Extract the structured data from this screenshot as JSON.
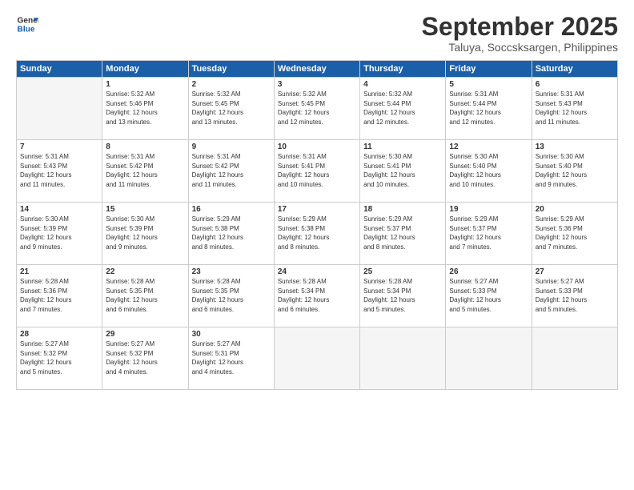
{
  "logo": {
    "line1": "General",
    "line2": "Blue"
  },
  "title": "September 2025",
  "subtitle": "Taluya, Soccsksargen, Philippines",
  "days_of_week": [
    "Sunday",
    "Monday",
    "Tuesday",
    "Wednesday",
    "Thursday",
    "Friday",
    "Saturday"
  ],
  "weeks": [
    [
      {
        "day": "",
        "info": ""
      },
      {
        "day": "1",
        "info": "Sunrise: 5:32 AM\nSunset: 5:46 PM\nDaylight: 12 hours\nand 13 minutes."
      },
      {
        "day": "2",
        "info": "Sunrise: 5:32 AM\nSunset: 5:45 PM\nDaylight: 12 hours\nand 13 minutes."
      },
      {
        "day": "3",
        "info": "Sunrise: 5:32 AM\nSunset: 5:45 PM\nDaylight: 12 hours\nand 12 minutes."
      },
      {
        "day": "4",
        "info": "Sunrise: 5:32 AM\nSunset: 5:44 PM\nDaylight: 12 hours\nand 12 minutes."
      },
      {
        "day": "5",
        "info": "Sunrise: 5:31 AM\nSunset: 5:44 PM\nDaylight: 12 hours\nand 12 minutes."
      },
      {
        "day": "6",
        "info": "Sunrise: 5:31 AM\nSunset: 5:43 PM\nDaylight: 12 hours\nand 11 minutes."
      }
    ],
    [
      {
        "day": "7",
        "info": "Sunrise: 5:31 AM\nSunset: 5:43 PM\nDaylight: 12 hours\nand 11 minutes."
      },
      {
        "day": "8",
        "info": "Sunrise: 5:31 AM\nSunset: 5:42 PM\nDaylight: 12 hours\nand 11 minutes."
      },
      {
        "day": "9",
        "info": "Sunrise: 5:31 AM\nSunset: 5:42 PM\nDaylight: 12 hours\nand 11 minutes."
      },
      {
        "day": "10",
        "info": "Sunrise: 5:31 AM\nSunset: 5:41 PM\nDaylight: 12 hours\nand 10 minutes."
      },
      {
        "day": "11",
        "info": "Sunrise: 5:30 AM\nSunset: 5:41 PM\nDaylight: 12 hours\nand 10 minutes."
      },
      {
        "day": "12",
        "info": "Sunrise: 5:30 AM\nSunset: 5:40 PM\nDaylight: 12 hours\nand 10 minutes."
      },
      {
        "day": "13",
        "info": "Sunrise: 5:30 AM\nSunset: 5:40 PM\nDaylight: 12 hours\nand 9 minutes."
      }
    ],
    [
      {
        "day": "14",
        "info": "Sunrise: 5:30 AM\nSunset: 5:39 PM\nDaylight: 12 hours\nand 9 minutes."
      },
      {
        "day": "15",
        "info": "Sunrise: 5:30 AM\nSunset: 5:39 PM\nDaylight: 12 hours\nand 9 minutes."
      },
      {
        "day": "16",
        "info": "Sunrise: 5:29 AM\nSunset: 5:38 PM\nDaylight: 12 hours\nand 8 minutes."
      },
      {
        "day": "17",
        "info": "Sunrise: 5:29 AM\nSunset: 5:38 PM\nDaylight: 12 hours\nand 8 minutes."
      },
      {
        "day": "18",
        "info": "Sunrise: 5:29 AM\nSunset: 5:37 PM\nDaylight: 12 hours\nand 8 minutes."
      },
      {
        "day": "19",
        "info": "Sunrise: 5:29 AM\nSunset: 5:37 PM\nDaylight: 12 hours\nand 7 minutes."
      },
      {
        "day": "20",
        "info": "Sunrise: 5:29 AM\nSunset: 5:36 PM\nDaylight: 12 hours\nand 7 minutes."
      }
    ],
    [
      {
        "day": "21",
        "info": "Sunrise: 5:28 AM\nSunset: 5:36 PM\nDaylight: 12 hours\nand 7 minutes."
      },
      {
        "day": "22",
        "info": "Sunrise: 5:28 AM\nSunset: 5:35 PM\nDaylight: 12 hours\nand 6 minutes."
      },
      {
        "day": "23",
        "info": "Sunrise: 5:28 AM\nSunset: 5:35 PM\nDaylight: 12 hours\nand 6 minutes."
      },
      {
        "day": "24",
        "info": "Sunrise: 5:28 AM\nSunset: 5:34 PM\nDaylight: 12 hours\nand 6 minutes."
      },
      {
        "day": "25",
        "info": "Sunrise: 5:28 AM\nSunset: 5:34 PM\nDaylight: 12 hours\nand 5 minutes."
      },
      {
        "day": "26",
        "info": "Sunrise: 5:27 AM\nSunset: 5:33 PM\nDaylight: 12 hours\nand 5 minutes."
      },
      {
        "day": "27",
        "info": "Sunrise: 5:27 AM\nSunset: 5:33 PM\nDaylight: 12 hours\nand 5 minutes."
      }
    ],
    [
      {
        "day": "28",
        "info": "Sunrise: 5:27 AM\nSunset: 5:32 PM\nDaylight: 12 hours\nand 5 minutes."
      },
      {
        "day": "29",
        "info": "Sunrise: 5:27 AM\nSunset: 5:32 PM\nDaylight: 12 hours\nand 4 minutes."
      },
      {
        "day": "30",
        "info": "Sunrise: 5:27 AM\nSunset: 5:31 PM\nDaylight: 12 hours\nand 4 minutes."
      },
      {
        "day": "",
        "info": ""
      },
      {
        "day": "",
        "info": ""
      },
      {
        "day": "",
        "info": ""
      },
      {
        "day": "",
        "info": ""
      }
    ]
  ]
}
